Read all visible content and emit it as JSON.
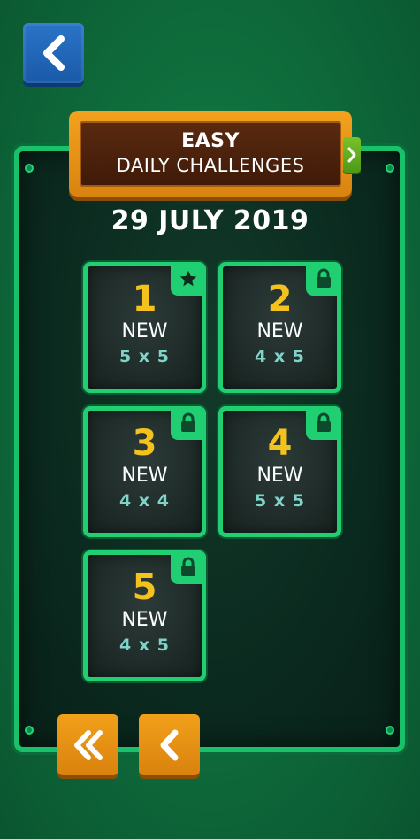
{
  "header": {
    "difficulty": "EASY",
    "subtitle": "DAILY CHALLENGES"
  },
  "date": "29 JULY 2019",
  "colors": {
    "tile_border": "#1fcf72",
    "number": "#f4c21e",
    "size_text": "#7fd3c8",
    "plaque": "#f3a21e",
    "back_button": "#2a74c8"
  },
  "icons": {
    "back": "chevron-left-icon",
    "next_mode": "chevron-right-icon",
    "first_page": "double-chevron-left-icon",
    "prev_page": "chevron-left-icon",
    "completed": "star-icon",
    "locked": "lock-icon"
  },
  "challenges": [
    {
      "number": "1",
      "status": "NEW",
      "size": "5 x 5",
      "badge": "star-icon"
    },
    {
      "number": "2",
      "status": "NEW",
      "size": "4 x 5",
      "badge": "lock-icon"
    },
    {
      "number": "3",
      "status": "NEW",
      "size": "4 x 4",
      "badge": "lock-icon"
    },
    {
      "number": "4",
      "status": "NEW",
      "size": "5 x 5",
      "badge": "lock-icon"
    },
    {
      "number": "5",
      "status": "NEW",
      "size": "4 x 5",
      "badge": "lock-icon"
    }
  ]
}
